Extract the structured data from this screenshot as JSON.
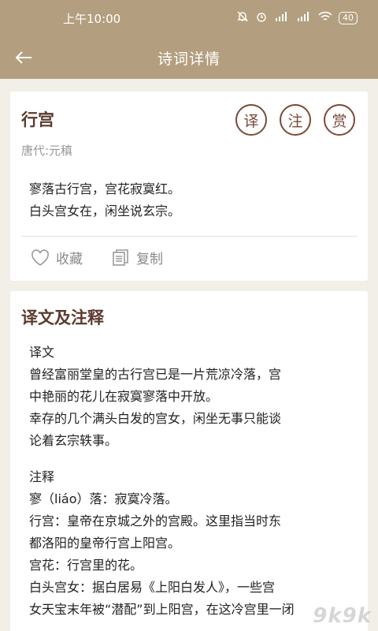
{
  "status_bar": {
    "time": "上午10:00",
    "battery": "40"
  },
  "app_bar": {
    "title": "诗词详情"
  },
  "poem": {
    "title": "行宫",
    "author": "唐代:元稹",
    "lines": [
      "寥落古行宫，宫花寂寞红。",
      "白头宫女在，闲坐说玄宗。"
    ],
    "buttons": {
      "translate": "译",
      "annotate": "注",
      "appreciate": "赏"
    },
    "actions": {
      "favorite": "收藏",
      "copy": "复制"
    }
  },
  "translation": {
    "section_title": "译文及注释",
    "translation_heading": "译文",
    "translation_lines": [
      "曾经富丽堂皇的古行宫已是一片荒凉冷落，宫",
      "中艳丽的花儿在寂寞寥落中开放。",
      "幸存的几个满头白发的宫女，闲坐无事只能谈",
      "论着玄宗轶事。"
    ],
    "notes_heading": "注释",
    "notes_lines": [
      "寥（liáo）落：寂寞冷落。",
      "行宫：皇帝在京城之外的宫殿。这里指当时东",
      "都洛阳的皇帝行宫上阳宫。",
      "宫花：行宫里的花。",
      "白头宫女：据白居易《上阳白发人》，一些宫",
      "女天宝末年被“潜配”到上阳宫，在这冷宫里一闭"
    ]
  },
  "watermark": "9k9k"
}
